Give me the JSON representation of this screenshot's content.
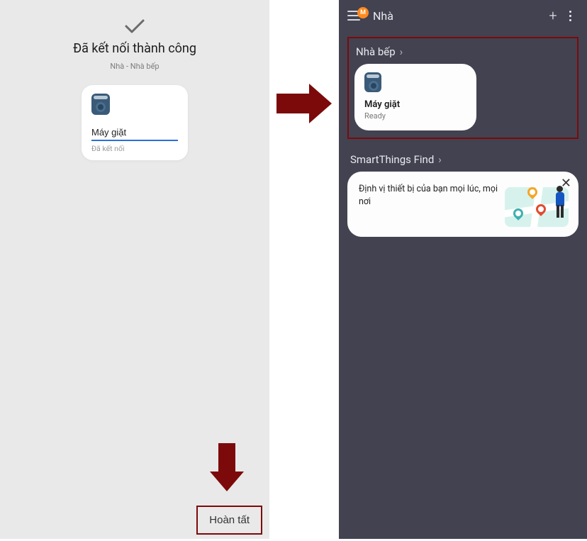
{
  "left": {
    "title": "Đã kết nối thành công",
    "location": "Nhà - Nhà bếp",
    "device_name": "Máy giặt",
    "device_status": "Đã kết nối",
    "complete_label": "Hoàn tất",
    "avatar_initial": "M"
  },
  "right": {
    "home_label": "Nhà",
    "room_name": "Nhà bếp",
    "tile_name": "Máy giặt",
    "tile_status": "Ready",
    "find_header": "SmartThings Find",
    "find_text": "Định vị thiết bị của bạn mọi lúc, mọi nơi"
  },
  "colors": {
    "highlight": "#7c0a0a"
  }
}
